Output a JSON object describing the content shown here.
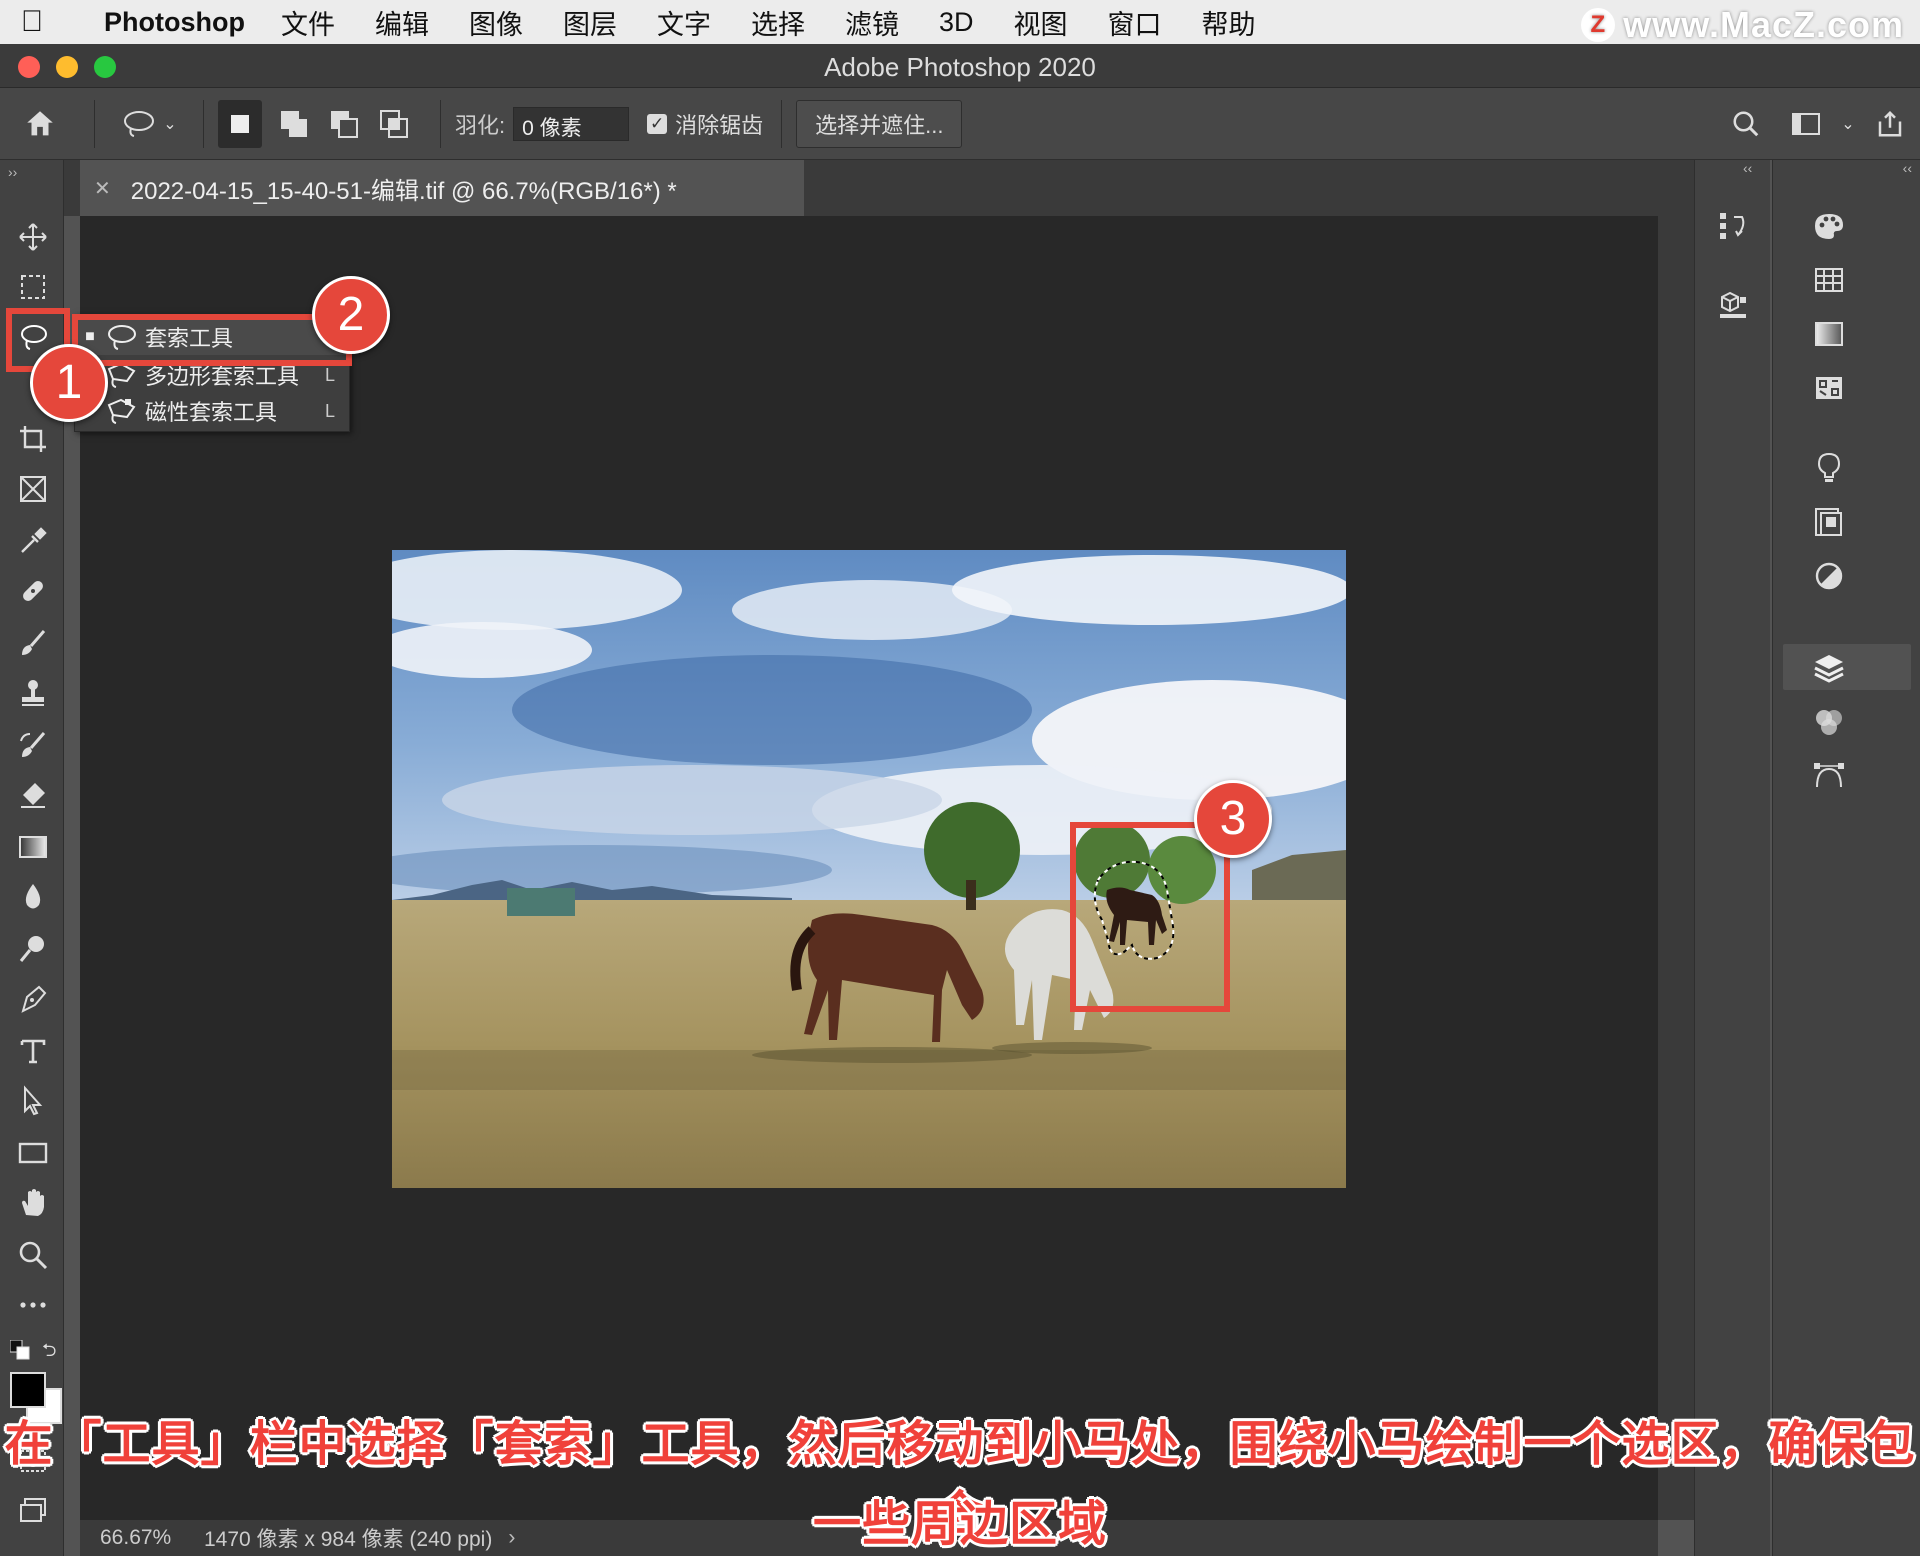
{
  "menubar": {
    "app": "Photoshop",
    "items": [
      "文件",
      "编辑",
      "图像",
      "图层",
      "文字",
      "选择",
      "滤镜",
      "3D",
      "视图",
      "窗口",
      "帮助"
    ],
    "watermark": "www.MacZ.com",
    "watermark_logo": "Z"
  },
  "window": {
    "title": "Adobe Photoshop 2020"
  },
  "options": {
    "feather_label": "羽化:",
    "feather_value": "0 像素",
    "antialias_label": "消除锯齿",
    "antialias_checked": true,
    "select_mask_label": "选择并遮住..."
  },
  "document": {
    "tab_title": "2022-04-15_15-40-51-编辑.tif @ 66.7%(RGB/16*) *"
  },
  "status": {
    "zoom": "66.67%",
    "info": "1470 像素 x 984 像素 (240 ppi)"
  },
  "flyout": {
    "items": [
      {
        "label": "套索工具",
        "key": "L",
        "active": true
      },
      {
        "label": "多边形套索工具",
        "key": "L",
        "active": false
      },
      {
        "label": "磁性套索工具",
        "key": "L",
        "active": false
      }
    ]
  },
  "annotations": {
    "badges": [
      "1",
      "2",
      "3"
    ],
    "caption_line1": "在「工具」栏中选择「套索」工具，然后移动到小马处，围绕小马绘制一个选区，确保包含",
    "caption_line2": "一些周边区域"
  },
  "colors": {
    "annotation_red": "#e5473b",
    "panel_bg": "#424242",
    "canvas_bg": "#282828"
  }
}
